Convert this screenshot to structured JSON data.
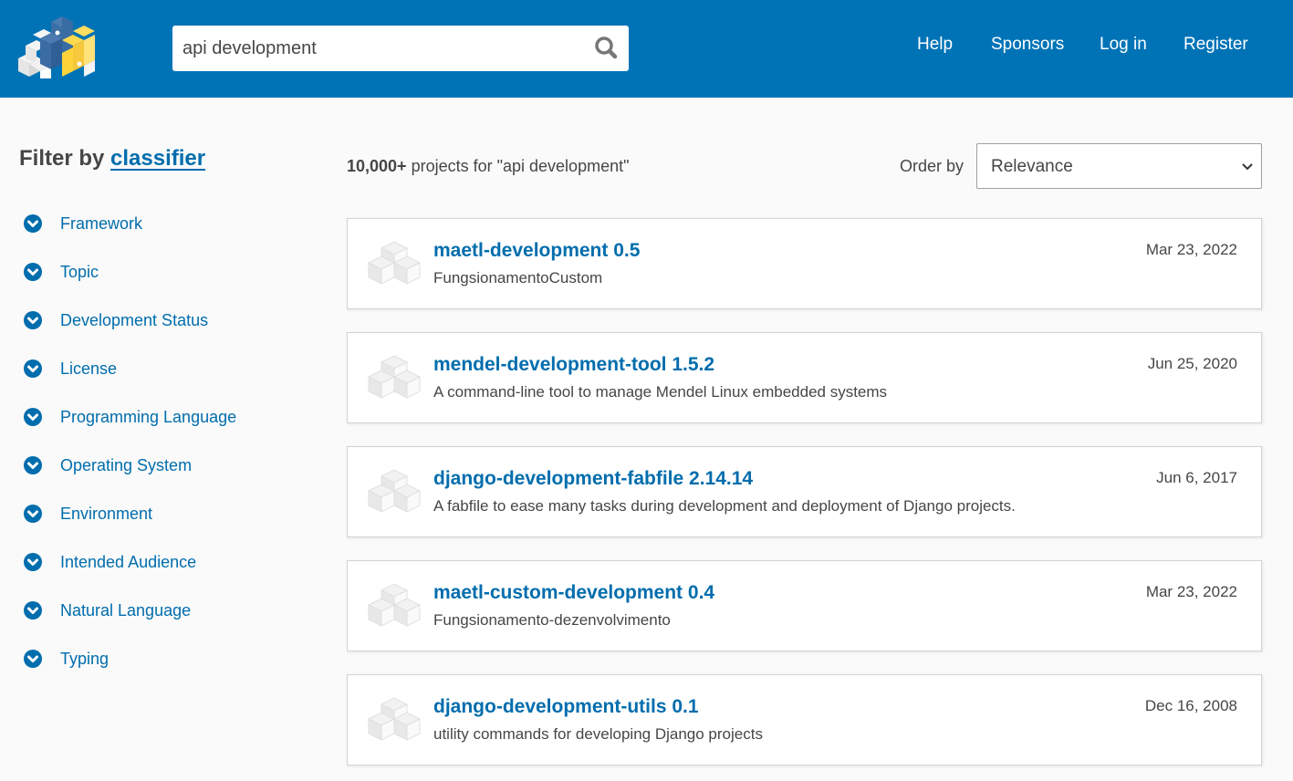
{
  "header": {
    "search": {
      "value": "api development",
      "placeholder": "Search projects"
    },
    "nav": [
      "Help",
      "Sponsors",
      "Log in",
      "Register"
    ]
  },
  "sidebar": {
    "title_prefix": "Filter by",
    "title_link": "classifier",
    "facets": [
      "Framework",
      "Topic",
      "Development Status",
      "License",
      "Programming Language",
      "Operating System",
      "Environment",
      "Intended Audience",
      "Natural Language",
      "Typing"
    ]
  },
  "results": {
    "count": "10,000+",
    "count_suffix": " projects for \"api development\"",
    "order_label": "Order by",
    "order_value": "Relevance",
    "items": [
      {
        "name": "maetl-development 0.5",
        "description": "FungsionamentoCustom",
        "date": "Mar 23, 2022"
      },
      {
        "name": "mendel-development-tool 1.5.2",
        "description": "A command-line tool to manage Mendel Linux embedded systems",
        "date": "Jun 25, 2020"
      },
      {
        "name": "django-development-fabfile 2.14.14",
        "description": "A fabfile to ease many tasks during development and deployment of Django projects.",
        "date": "Jun 6, 2017"
      },
      {
        "name": "maetl-custom-development 0.4",
        "description": "Fungsionamento-dezenvolvimento",
        "date": "Mar 23, 2022"
      },
      {
        "name": "django-development-utils 0.1",
        "description": "utility commands for developing Django projects",
        "date": "Dec 16, 2008"
      }
    ]
  },
  "colors": {
    "header_bg": "#0073b7",
    "link": "#006dad",
    "text": "#464646",
    "page_bg": "#fafafa"
  }
}
